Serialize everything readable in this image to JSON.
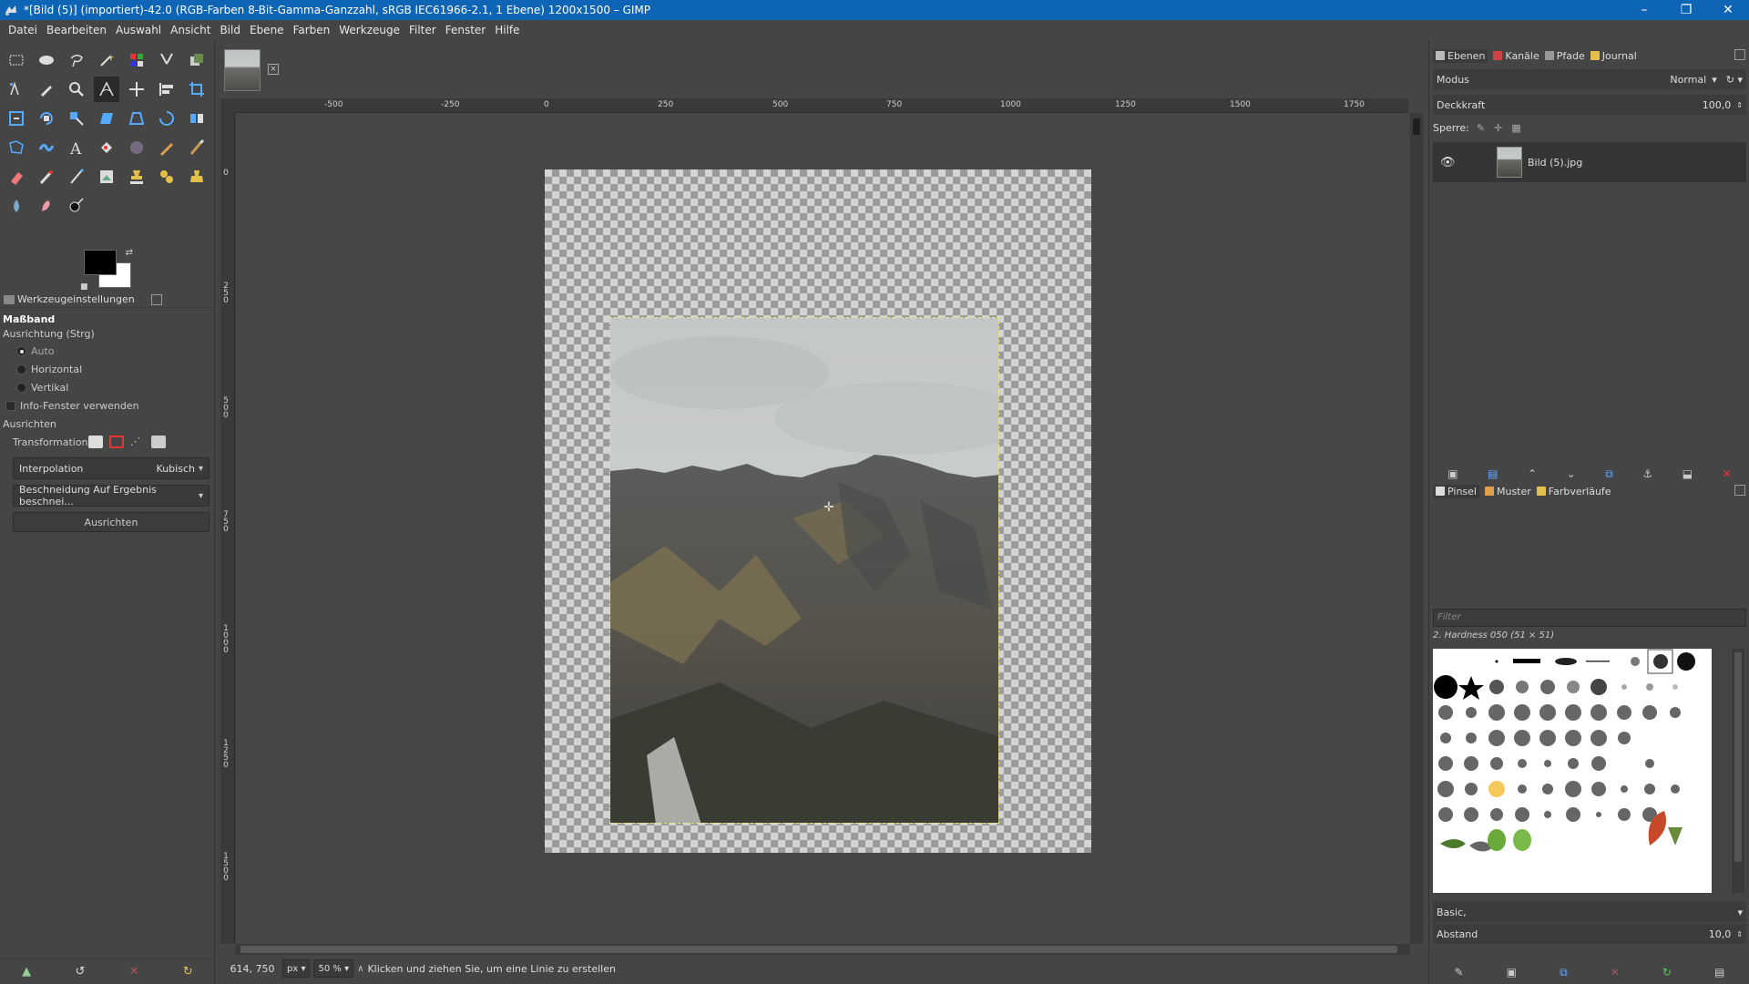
{
  "window": {
    "title": "*[Bild (5)] (importiert)-42.0 (RGB-Farben 8-Bit-Gamma-Ganzzahl, sRGB IEC61966-2.1, 1 Ebene) 1200x1500 – GIMP",
    "minimize": "–",
    "maximize": "❐",
    "close": "✕"
  },
  "menu": [
    "Datei",
    "Bearbeiten",
    "Auswahl",
    "Ansicht",
    "Bild",
    "Ebene",
    "Farben",
    "Werkzeuge",
    "Filter",
    "Fenster",
    "Hilfe"
  ],
  "tool_options": {
    "tab_label": "Werkzeugeinstellungen",
    "tool_name": "Maßband",
    "orientation_label": "Ausrichtung (Strg)",
    "orientation_options": [
      "Auto",
      "Horizontal",
      "Vertikal"
    ],
    "orientation_selected": "Auto",
    "info_window_label": "Info-Fenster verwenden",
    "info_window_checked": false,
    "align_label": "Ausrichten",
    "transform_label": "Transformation:",
    "interpolation_label": "Interpolation",
    "interpolation_value": "Kubisch",
    "clipping_value": "Beschneidung Auf Ergebnis beschnei...",
    "align_button": "Ausrichten"
  },
  "colors": {
    "foreground": "#000000",
    "background": "#ffffff"
  },
  "ruler": {
    "h_labels": [
      "-500",
      "-250",
      "0",
      "250",
      "500",
      "750",
      "1000",
      "1250",
      "1500",
      "1750"
    ],
    "v_labels": [
      "0",
      "250",
      "500",
      "750",
      "1000",
      "1250",
      "1500"
    ]
  },
  "status": {
    "coordinates": "614, 750",
    "unit": "px",
    "zoom": "50 %",
    "message": "Klicken und ziehen Sie, um eine Linie zu erstellen"
  },
  "layers_panel": {
    "tabs": [
      "Ebenen",
      "Kanäle",
      "Pfade",
      "Journal"
    ],
    "mode_label": "Modus",
    "mode_value": "Normal",
    "opacity_label": "Deckkraft",
    "opacity_value": "100,0",
    "lock_label": "Sperre:",
    "layer_name": "Bild (5).jpg"
  },
  "brushes_panel": {
    "tabs": [
      "Pinsel",
      "Muster",
      "Farbverläufe"
    ],
    "filter_placeholder": "Filter",
    "selected_brush": "2. Hardness 050 (51 × 51)",
    "preset": "Basic,",
    "spacing_label": "Abstand",
    "spacing_value": "10,0"
  }
}
